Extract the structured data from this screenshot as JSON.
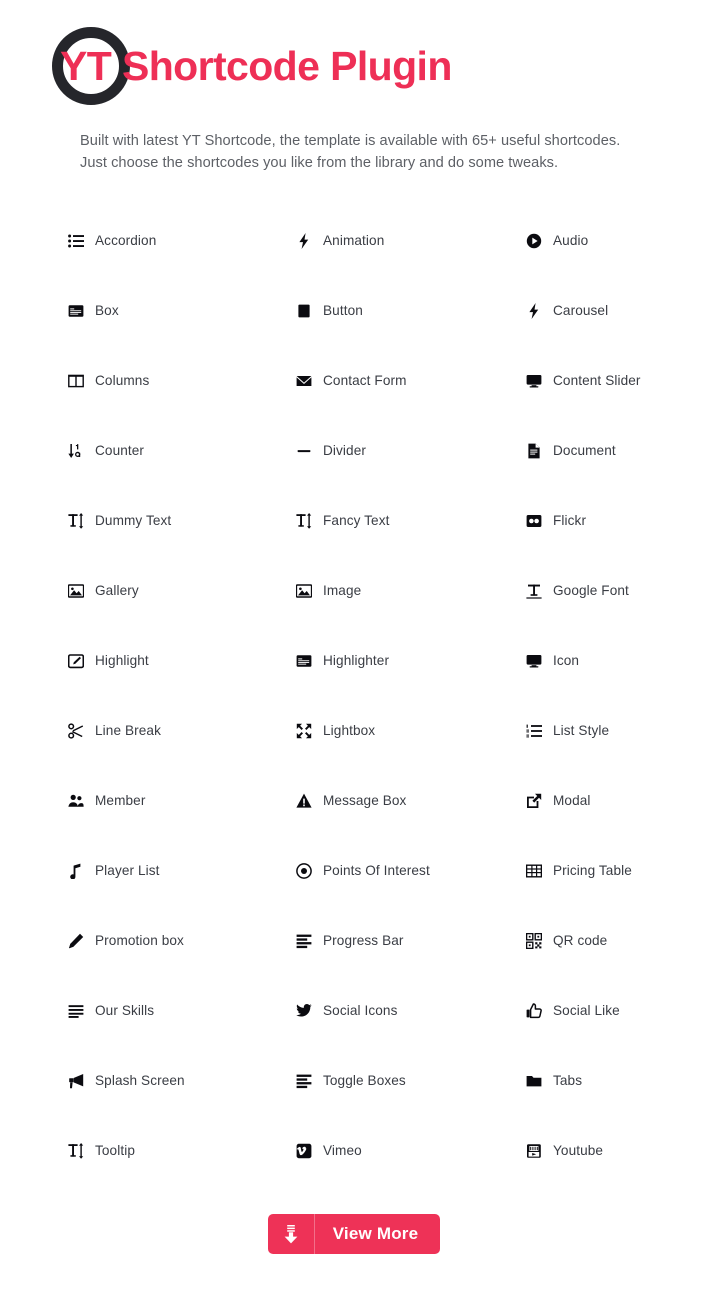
{
  "header": {
    "logo_badge": "YT",
    "title_prefix": "YT",
    "title_rest": "Shortcode Plugin",
    "title_full": "YT Shortcode Plugin",
    "subtitle_line1": "Built with latest YT Shortcode, the template is available with 65+ useful shortcodes.",
    "subtitle_line2": "Just choose the shortcodes you like from the library and do some tweaks."
  },
  "colors": {
    "accent": "#ee2f56",
    "button": "#ee3257",
    "logo_ring": "#25262b",
    "label_text": "#3a3d44",
    "subtitle_text": "#5d6066",
    "icon": "#0b0b10",
    "background": "#ffffff"
  },
  "shortcodes": [
    {
      "label": "Accordion",
      "icon": "list-ul-icon"
    },
    {
      "label": "Animation",
      "icon": "bolt-icon"
    },
    {
      "label": "Audio",
      "icon": "play-circle-icon"
    },
    {
      "label": "Box",
      "icon": "window-maximize-icon"
    },
    {
      "label": "Button",
      "icon": "square-filled-icon"
    },
    {
      "label": "Carousel",
      "icon": "bolt-icon"
    },
    {
      "label": "Columns",
      "icon": "columns-icon"
    },
    {
      "label": "Contact Form",
      "icon": "envelope-icon"
    },
    {
      "label": "Content Slider",
      "icon": "desktop-icon"
    },
    {
      "label": "Counter",
      "icon": "sort-numeric-down-icon"
    },
    {
      "label": "Divider",
      "icon": "minus-icon"
    },
    {
      "label": "Document",
      "icon": "file-text-icon"
    },
    {
      "label": "Dummy Text",
      "icon": "text-height-icon"
    },
    {
      "label": "Fancy Text",
      "icon": "text-height-icon"
    },
    {
      "label": "Flickr",
      "icon": "flickr-icon"
    },
    {
      "label": "Gallery",
      "icon": "image-icon"
    },
    {
      "label": "Image",
      "icon": "image-icon"
    },
    {
      "label": "Google Font",
      "icon": "text-width-icon"
    },
    {
      "label": "Highlight",
      "icon": "pen-square-icon"
    },
    {
      "label": "Highlighter",
      "icon": "window-maximize-icon"
    },
    {
      "label": "Icon",
      "icon": "desktop-icon"
    },
    {
      "label": "Line Break",
      "icon": "scissors-icon"
    },
    {
      "label": "Lightbox",
      "icon": "expand-arrows-icon"
    },
    {
      "label": "List Style",
      "icon": "list-ol-icon"
    },
    {
      "label": "Member",
      "icon": "users-icon"
    },
    {
      "label": "Message Box",
      "icon": "exclamation-triangle-icon"
    },
    {
      "label": "Modal",
      "icon": "external-link-icon"
    },
    {
      "label": "Player List",
      "icon": "music-note-icon"
    },
    {
      "label": "Points Of Interest",
      "icon": "dot-circle-icon"
    },
    {
      "label": "Pricing Table",
      "icon": "table-icon"
    },
    {
      "label": "Promotion box",
      "icon": "pencil-icon"
    },
    {
      "label": "Progress Bar",
      "icon": "align-left-bars-icon"
    },
    {
      "label": "QR code",
      "icon": "qrcode-icon"
    },
    {
      "label": "Our Skills",
      "icon": "align-justify-icon"
    },
    {
      "label": "Social Icons",
      "icon": "twitter-icon"
    },
    {
      "label": "Social Like",
      "icon": "thumbs-up-icon"
    },
    {
      "label": "Splash Screen",
      "icon": "bullhorn-icon"
    },
    {
      "label": "Toggle Boxes",
      "icon": "align-left-bars-icon"
    },
    {
      "label": "Tabs",
      "icon": "folder-icon"
    },
    {
      "label": "Tooltip",
      "icon": "text-height-icon"
    },
    {
      "label": "Vimeo",
      "icon": "vimeo-icon"
    },
    {
      "label": "Youtube",
      "icon": "youtube-icon"
    }
  ],
  "cta": {
    "label": "View More",
    "icon": "download-arrow-icon"
  }
}
